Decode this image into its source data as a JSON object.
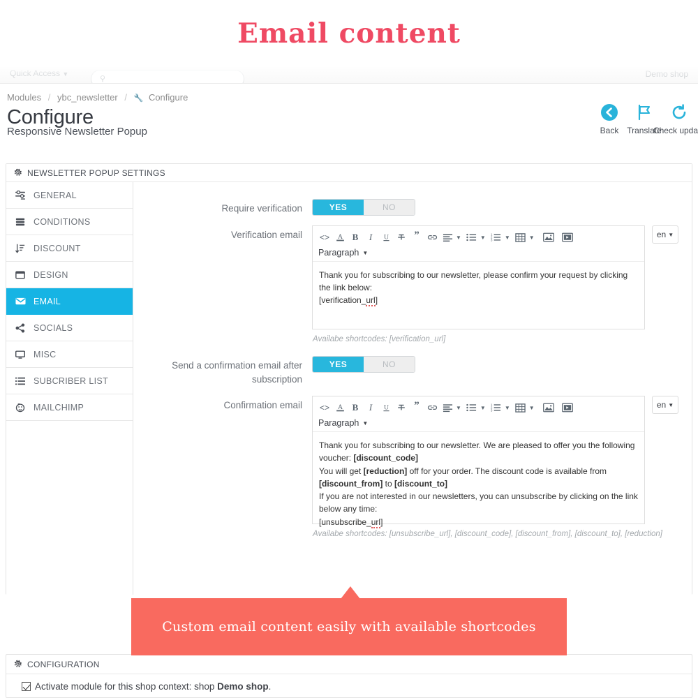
{
  "hero": {
    "title": "Email content",
    "accent": "#ef4a63"
  },
  "topbar": {
    "quick_access": "Quick Access",
    "search_placeholder": "Search",
    "shop": "Demo shop"
  },
  "header": {
    "breadcrumb": [
      "Modules",
      "ybc_newsletter",
      "Configure"
    ],
    "title": "Configure",
    "subtitle": "Responsive Newsletter Popup",
    "actions": [
      {
        "icon": "back-arrow-icon",
        "label": "Back"
      },
      {
        "icon": "flag-icon",
        "label": "Translate"
      },
      {
        "icon": "refresh-icon",
        "label": "Check update"
      }
    ]
  },
  "panel": {
    "title": "NEWSLETTER POPUP SETTINGS",
    "icon": "gear-icon"
  },
  "sidebar": {
    "items": [
      {
        "label": "GENERAL",
        "icon": "sliders-icon",
        "active": false
      },
      {
        "label": "CONDITIONS",
        "icon": "server-icon",
        "active": false
      },
      {
        "label": "DISCOUNT",
        "icon": "sort-icon",
        "active": false
      },
      {
        "label": "DESIGN",
        "icon": "window-icon",
        "active": false
      },
      {
        "label": "EMAIL",
        "icon": "envelope-icon",
        "active": true
      },
      {
        "label": "SOCIALS",
        "icon": "share-icon",
        "active": false
      },
      {
        "label": "MISC",
        "icon": "monitor-icon",
        "active": false
      },
      {
        "label": "SUBCRIBER LIST",
        "icon": "list-icon",
        "active": false
      },
      {
        "label": "MAILCHIMP",
        "icon": "mailchimp-icon",
        "active": false
      }
    ]
  },
  "toolbar_buttons": [
    {
      "name": "source-code-icon",
      "glyph": "<>"
    },
    {
      "name": "text-color-icon",
      "glyph": "A"
    },
    {
      "name": "bold-icon",
      "glyph": "B"
    },
    {
      "name": "italic-icon",
      "glyph": "I"
    },
    {
      "name": "underline-icon",
      "glyph": "U"
    },
    {
      "name": "strikethrough-icon",
      "glyph": "S"
    },
    {
      "name": "blockquote-icon",
      "glyph": "”"
    },
    {
      "name": "link-icon",
      "glyph": "link"
    },
    {
      "name": "align-icon",
      "glyph": "align"
    },
    {
      "name": "unordered-list-icon",
      "glyph": "ul"
    },
    {
      "name": "ordered-list-icon",
      "glyph": "ol"
    },
    {
      "name": "table-icon",
      "glyph": "table"
    },
    {
      "name": "image-icon",
      "glyph": "image"
    },
    {
      "name": "video-icon",
      "glyph": "video"
    }
  ],
  "form": {
    "require_verification": {
      "label": "Require verification",
      "yes": "YES",
      "no": "NO",
      "value": "YES"
    },
    "verification_email": {
      "label": "Verification email",
      "format_select": "Paragraph",
      "language": "en",
      "body_lines": [
        "Thank you for subscribing to our newsletter, please confirm your request by clicking the link below:",
        "[verification_url]"
      ],
      "hint": "Availabe shortcodes: [verification_url]"
    },
    "send_confirmation": {
      "label": "Send a confirmation email after subscription",
      "yes": "YES",
      "no": "NO",
      "value": "YES"
    },
    "confirmation_email": {
      "label": "Confirmation email",
      "format_select": "Paragraph",
      "language": "en",
      "body_lines": [
        "Thank you for subscribing to our newsletter. We are pleased to offer you the following voucher: [discount_code]",
        "You will get [reduction] off for your order. The discount code is available from [discount_from] to [discount_to]",
        "If you are not interested in our newsletters, you can unsubscribe by clicking on the link below any time:",
        "[unsubscribe_url]"
      ],
      "hint": "Availabe shortcodes: [unsubscribe_url], [discount_code], [discount_from], [discount_to], [reduction]"
    }
  },
  "callout": {
    "text": "Custom email content easily with available shortcodes",
    "color": "#f96a5f"
  },
  "configuration": {
    "title": "CONFIGURATION",
    "icon": "gear-icon",
    "checkbox_label_before": "Activate module for this shop context: shop ",
    "checkbox_shop": "Demo shop",
    "checkbox_label_after": ".",
    "checked": true
  }
}
